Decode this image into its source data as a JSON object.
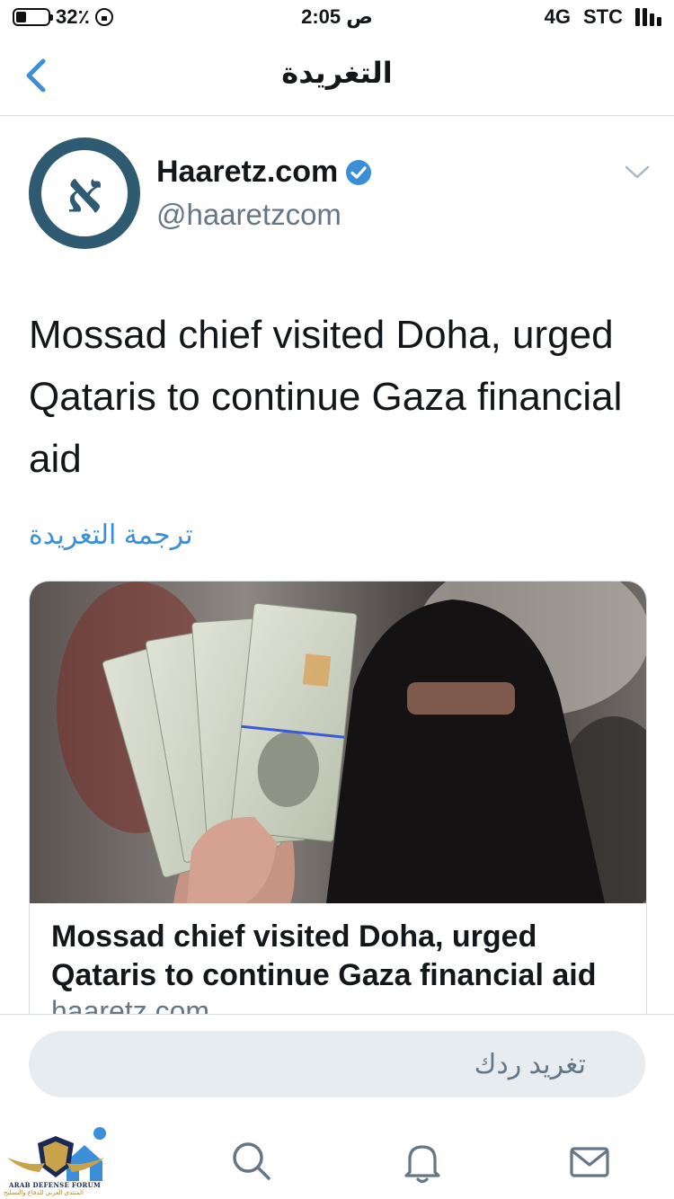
{
  "status_bar": {
    "battery_percent": "32٪",
    "battery_level": 0.32,
    "time": "2:05 ص",
    "network": "4G",
    "carrier": "STC"
  },
  "nav": {
    "title": "التغريدة"
  },
  "tweet": {
    "display_name": "Haaretz.com",
    "handle": "@haaretzcom",
    "avatar_glyph": "א",
    "verified": true,
    "text": "Mossad chief visited Doha, urged Qataris to continue Gaza financial aid",
    "translate_label": "ترجمة التغريدة"
  },
  "card": {
    "title": "Mossad chief visited Doha, urged Qataris to continue Gaza financial aid",
    "domain": "haaretz.com"
  },
  "reply": {
    "placeholder": "تغريد ردك"
  },
  "watermark": {
    "english": "ARAB DEFENSE FORUM",
    "arabic": "المنتدى العربي للدفاع والتسليح"
  },
  "colors": {
    "accent": "#3c8fd6",
    "avatar_bg": "#2e5a72",
    "muted_text": "#657786"
  }
}
